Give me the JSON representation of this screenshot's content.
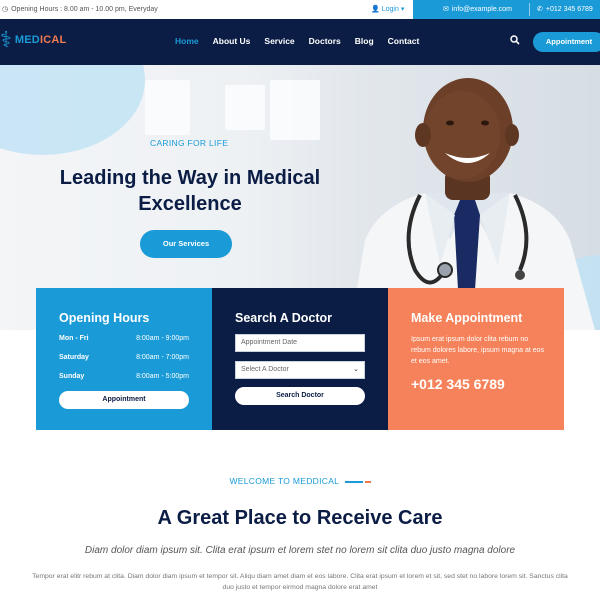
{
  "topbar": {
    "opening_hours": "Opening Hours : 8.00 am - 10.00 pm, Everyday",
    "login": "Login",
    "email": "info@example.com",
    "phone": "+012 345 6789"
  },
  "nav": {
    "logo_part1": "MED",
    "logo_part2": "ICAL",
    "items": [
      "Home",
      "About Us",
      "Service",
      "Doctors",
      "Blog",
      "Contact"
    ],
    "appointment": "Appointment"
  },
  "hero": {
    "tagline": "CARING FOR LIFE",
    "title": "Leading the Way in Medical Excellence",
    "button": "Our Services"
  },
  "opening_hours": {
    "title": "Opening Hours",
    "rows": [
      {
        "day": "Mon - Fri",
        "time": "8:00am - 9:00pm"
      },
      {
        "day": "Saturday",
        "time": "8:00am - 7:00pm"
      },
      {
        "day": "Sunday",
        "time": "8:00am - 5:00pm"
      }
    ],
    "button": "Appointment"
  },
  "search_doctor": {
    "title": "Search A Doctor",
    "date_placeholder": "Appointment Date",
    "select_value": "Select A Doctor",
    "button": "Search Doctor"
  },
  "make_appointment": {
    "title": "Make Appointment",
    "text": "Ipsum erat ipsum dolor clita rebum no rebum dolores labore, ipsum magna at eos et eos amet.",
    "phone": "+012 345 6789"
  },
  "welcome": {
    "subtitle": "WELCOME TO MEDDICAL",
    "title": "A Great Place to Receive Care",
    "lead": "Diam dolor diam ipsum sit. Clita erat ipsum et lorem stet no lorem sit clita duo justo magna dolore",
    "body": "Tempor erat elitr rebum at clita. Diam dolor diam ipsum et tempor sit. Aliqu diam amet diam et eos labore. Clita erat ipsum et lorem et sit, sed stet no labore lorem sit. Sanctus clita duo justo et tempor eirmod magna dolore erat amet"
  },
  "colors": {
    "brand_blue": "#1a9bd7",
    "navy": "#0b1d45",
    "orange": "#f5825a"
  }
}
